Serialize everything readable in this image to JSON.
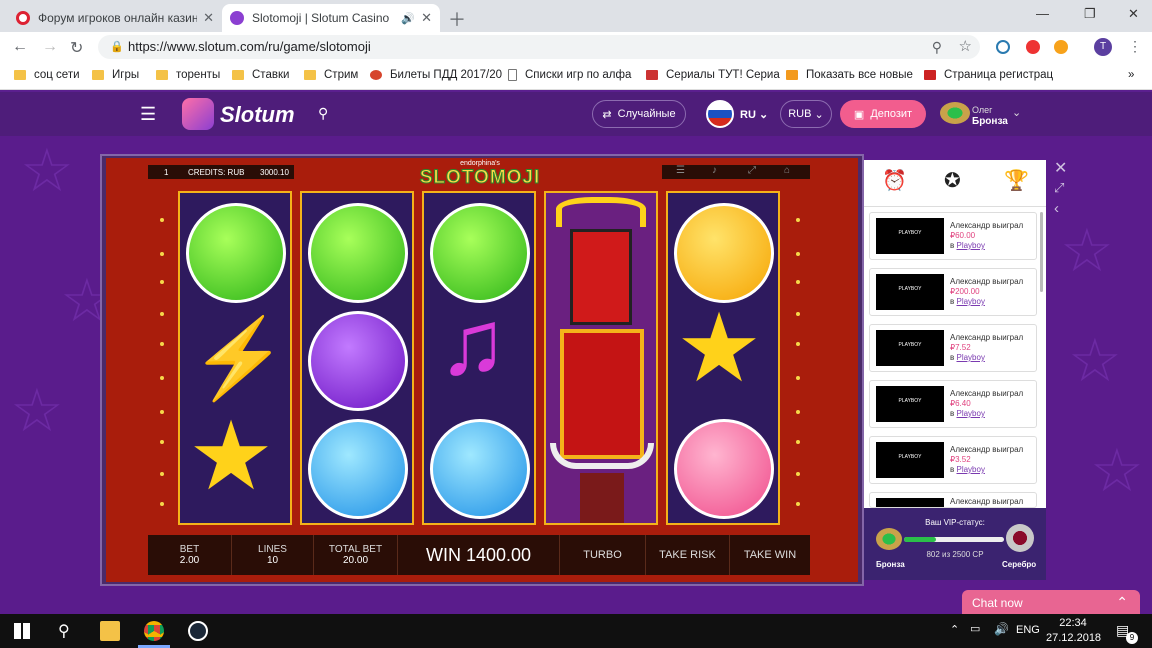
{
  "browser": {
    "tabs": [
      {
        "title": "Форум игроков онлайн казино",
        "active": false
      },
      {
        "title": "Slotomoji | Slotum Casino",
        "active": true
      }
    ],
    "url": "https://www.slotum.com/ru/game/slotomoji",
    "bookmarks": [
      "соц сети",
      "Игры",
      "торенты",
      "Ставки",
      "Стрим",
      "Билеты ПДД 2017/20",
      "Списки игр по алфа",
      "Сериалы ТУТ! Сериа",
      "Показать все новые",
      "Страница регистрац"
    ],
    "profile_initial": "T"
  },
  "site": {
    "logo": "Slotum",
    "random_label": "Случайные",
    "lang": "RU",
    "currency": "RUB",
    "deposit_label": "Депозит",
    "user_name": "Олег",
    "user_status": "Бронза"
  },
  "game": {
    "title_small": "endorphina's",
    "title": "SLOTOMOJI",
    "line_num": "1",
    "credits_label": "CREDITS: RUB",
    "credits_value": "3000.10",
    "bet_label": "BET",
    "bet_value": "2.00",
    "lines_label": "LINES",
    "lines_value": "10",
    "total_bet_label": "TOTAL BET",
    "total_bet_value": "20.00",
    "win_text": "WIN 1400.00",
    "turbo_label": "TURBO",
    "take_risk_label": "TAKE RISK",
    "take_win_label": "TAKE WIN"
  },
  "feed": [
    {
      "text": "Александр выиграл",
      "amount": "₽60.00",
      "prefix": "в",
      "game": "Playboy"
    },
    {
      "text": "Александр выиграл",
      "amount": "₽200.00",
      "prefix": "в",
      "game": "Playboy"
    },
    {
      "text": "Александр выиграл",
      "amount": "₽7.52",
      "prefix": "в",
      "game": "Playboy"
    },
    {
      "text": "Александр выиграл",
      "amount": "₽6.40",
      "prefix": "в",
      "game": "Playboy"
    },
    {
      "text": "Александр выиграл",
      "amount": "₽3.52",
      "prefix": "в",
      "game": "Playboy"
    },
    {
      "text": "Александр выиграл",
      "amount": "",
      "prefix": "",
      "game": ""
    }
  ],
  "vip": {
    "title": "Ваш VIP-статус:",
    "progress_text": "802 из 2500 СР",
    "progress_fraction": 0.32,
    "from": "Бронза",
    "to": "Серебро"
  },
  "chat_label": "Chat now",
  "taskbar": {
    "lang": "ENG",
    "time": "22:34",
    "date": "27.12.2018",
    "notif_count": "9"
  },
  "colors": {
    "site_bg": "#5a1c8c",
    "game_bg": "#a91d0c",
    "reel_border": "#f4b31a",
    "deposit": "#f25d8e",
    "chat": "#e86592"
  }
}
